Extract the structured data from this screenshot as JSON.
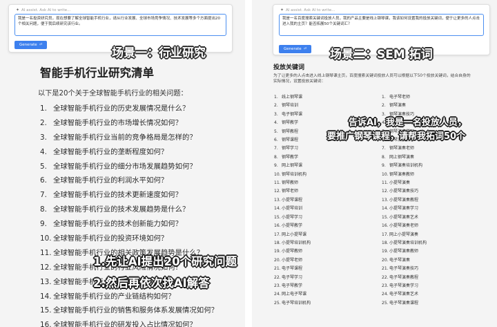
{
  "scene1": {
    "assistant_hint": "AI assist. Ask AI to write...",
    "prompt_text": "我是一名投资研究员，现在想要了解全球智能手机行业，请从行业发展、全球市场竞争情况、技术发展等多个方面提出20个相关问题，便于我后续研究该行业。",
    "generate_label": "Generate",
    "label": "场景一：行业研究"
  },
  "left_doc": {
    "title": "智能手机行业研究清单",
    "intro": "以下是20个关于全球智能手机行业的相关问题：",
    "questions": [
      {
        "num": "1.",
        "text": "全球智能手机行业的历史发展情况是什么？"
      },
      {
        "num": "2.",
        "text": "全球智能手机行业的市场增长情况如何？"
      },
      {
        "num": "3.",
        "text": "全球智能手机行业当前的竞争格局是怎样的？"
      },
      {
        "num": "4.",
        "text": "全球智能手机行业的垄断程度如何？"
      },
      {
        "num": "5.",
        "text": "全球智能手机行业的细分市场发展趋势如何？"
      },
      {
        "num": "6.",
        "text": "全球智能手机行业的利润水平如何？"
      },
      {
        "num": "7.",
        "text": "全球智能手机行业的技术更新速度如何？"
      },
      {
        "num": "8.",
        "text": "全球智能手机行业的技术发展趋势是什么？"
      },
      {
        "num": "9.",
        "text": "全球智能手机行业的技术创新能力如何？"
      },
      {
        "num": "10.",
        "text": "全球智能手机行业的投资环境如何？"
      },
      {
        "num": "11.",
        "text": "全球智能手机行业的相关政策发展趋势是什么？"
      },
      {
        "num": "12.",
        "text": "全球智能手机行业的行业风险情况如何？"
      },
      {
        "num": "13.",
        "text": "全球智能手机行业的行业杠杆率情况如何？"
      },
      {
        "num": "14.",
        "text": "全球智能手机行业的产业链结构如何？"
      },
      {
        "num": "15.",
        "text": "全球智能手机行业的销售和服务体系发展情况如何？"
      },
      {
        "num": "16.",
        "text": "全球智能手机行业的研发投入占比情况如何？"
      }
    ],
    "annotation_1": "1.先让AI提出20个研究问题",
    "annotation_2": "2.然后再依次找AI解答"
  },
  "scene2": {
    "assistant_hint": "AI assist. Ask AI to write...",
    "prompt_text": "我是一名百度搜索关键词投放人员，我的产品主要是线上钢琴课，我该如何设置我的投放关键词，便于让更多的人点击进入我的主页？能否拓展50个关键词汇？",
    "generate_label": "Generate",
    "label": "场景二：SEM 拓词"
  },
  "right_doc": {
    "title": "投放关键词",
    "intro": "为了让更多的人点击进入线上钢琴课主页，百度搜索关键词投放人员可以根据以下50个投放关键词，结合自身的实际情况，设置投放关键词：",
    "col1": [
      {
        "num": "1.",
        "text": "线上钢琴课"
      },
      {
        "num": "2.",
        "text": "钢琴培训"
      },
      {
        "num": "3.",
        "text": "电子钢琴课"
      },
      {
        "num": "4.",
        "text": "钢琴教学"
      },
      {
        "num": "5.",
        "text": "钢琴教程"
      },
      {
        "num": "6.",
        "text": "钢琴课程"
      },
      {
        "num": "7.",
        "text": "钢琴学习"
      },
      {
        "num": "8.",
        "text": "钢琴教学"
      },
      {
        "num": "9.",
        "text": "网上钢琴课"
      },
      {
        "num": "10.",
        "text": "钢琴培训机构"
      },
      {
        "num": "11.",
        "text": "钢琴教师"
      },
      {
        "num": "12.",
        "text": "钢琴老师"
      },
      {
        "num": "13.",
        "text": "小提琴课程"
      },
      {
        "num": "14.",
        "text": "小提琴培训"
      },
      {
        "num": "15.",
        "text": "小提琴学习"
      },
      {
        "num": "16.",
        "text": "小提琴教学"
      },
      {
        "num": "17.",
        "text": "网上小提琴课"
      },
      {
        "num": "18.",
        "text": "小提琴培训机构"
      },
      {
        "num": "19.",
        "text": "小提琴教师"
      },
      {
        "num": "20.",
        "text": "小提琴老师"
      },
      {
        "num": "21.",
        "text": "电子琴课程"
      },
      {
        "num": "22.",
        "text": "电子琴学习"
      },
      {
        "num": "23.",
        "text": "电子琴教学"
      },
      {
        "num": "24.",
        "text": "网上电子琴课"
      },
      {
        "num": "25.",
        "text": "电子琴培训机构"
      }
    ],
    "col2": [
      {
        "num": "1.",
        "text": "电子琴老师"
      },
      {
        "num": "2.",
        "text": "钢琴演奏"
      },
      {
        "num": "3.",
        "text": "钢琴演奏技巧"
      },
      {
        "num": "4.",
        "text": "钢琴演奏教程"
      },
      {
        "num": "5.",
        "text": "钢琴演奏学习"
      },
      {
        "num": "6.",
        "text": "钢琴演奏教学"
      },
      {
        "num": "7.",
        "text": "钢琴演奏老师"
      },
      {
        "num": "8.",
        "text": "网上钢琴演奏"
      },
      {
        "num": "9.",
        "text": "钢琴演奏培训机构"
      },
      {
        "num": "10.",
        "text": "钢琴演奏教师"
      },
      {
        "num": "11.",
        "text": "小提琴演奏"
      },
      {
        "num": "12.",
        "text": "小提琴演奏技巧"
      },
      {
        "num": "13.",
        "text": "小提琴演奏教程"
      },
      {
        "num": "14.",
        "text": "小提琴演奏学习"
      },
      {
        "num": "15.",
        "text": "小提琴演奏艺术"
      },
      {
        "num": "16.",
        "text": "小提琴演奏老师"
      },
      {
        "num": "17.",
        "text": "网上小提琴演奏"
      },
      {
        "num": "18.",
        "text": "小提琴演奏培训机构"
      },
      {
        "num": "19.",
        "text": "小提琴演奏教师"
      },
      {
        "num": "20.",
        "text": "电子琴演奏"
      },
      {
        "num": "21.",
        "text": "电子琴演奏技巧"
      },
      {
        "num": "22.",
        "text": "电子琴演奏教程"
      },
      {
        "num": "23.",
        "text": "电子琴演奏学习"
      },
      {
        "num": "24.",
        "text": "电子琴演奏艺术"
      },
      {
        "num": "25.",
        "text": "电子琴演奏课程"
      }
    ],
    "annotation_1": "告诉AI，我是一名投放人员，",
    "annotation_2": "要推广钢琴课程，请帮我拓词50个"
  },
  "icons": {
    "assist": "sparkle-icon",
    "enter": "enter-key-icon"
  }
}
